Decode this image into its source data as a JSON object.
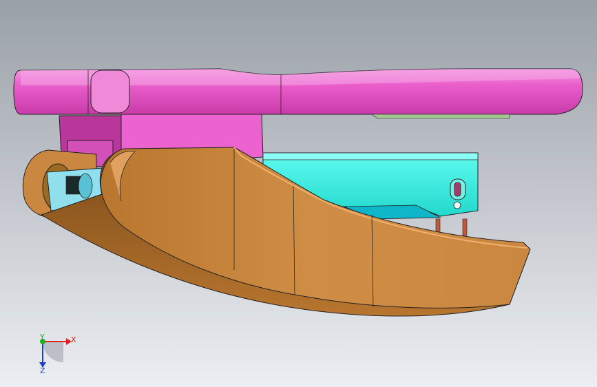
{
  "viewport": {
    "background_top": "#9aa0a8",
    "background_bottom": "#e8eaee"
  },
  "model": {
    "parts": [
      {
        "name": "top-handle",
        "color": "#e85ac8"
      },
      {
        "name": "bracket",
        "color": "#e85ac8"
      },
      {
        "name": "inner-slider",
        "color": "#33f5e6"
      },
      {
        "name": "lever",
        "color": "#c98740"
      },
      {
        "name": "pins",
        "color": "#c05a3a"
      }
    ]
  },
  "triad": {
    "x_label": "X",
    "y_label": "Y",
    "z_label": "Z",
    "x_color": "#e02020",
    "y_color": "#20b020",
    "z_color": "#2040d0"
  }
}
